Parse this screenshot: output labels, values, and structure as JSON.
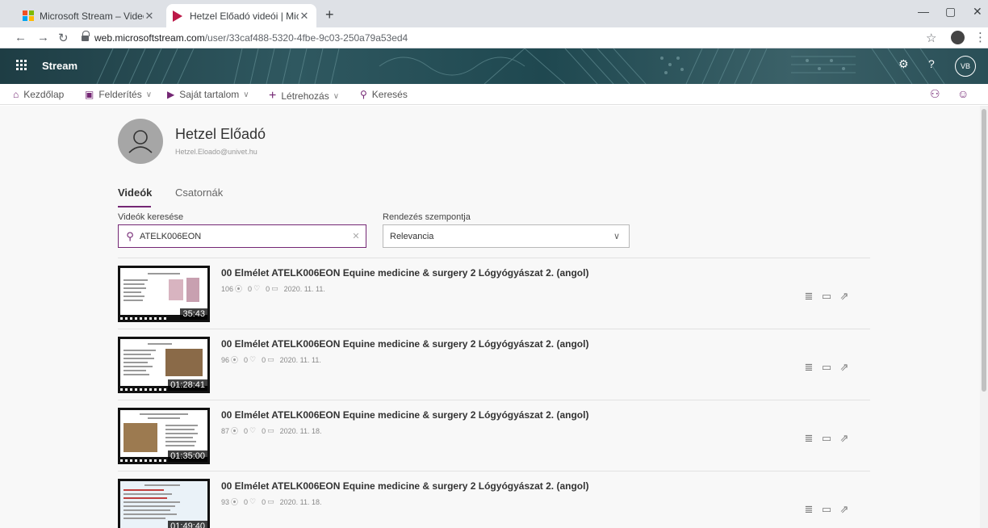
{
  "browser": {
    "tabs": [
      {
        "title": "Microsoft Stream – Videómegosz",
        "active": false
      },
      {
        "title": "Hetzel Előadó videói | Microsoft",
        "active": true
      }
    ],
    "url_host": "web.microsoftstream.com",
    "url_path": "/user/33caf488-5320-4fbe-9c03-250a79a53ed4"
  },
  "header": {
    "app_name": "Stream",
    "avatar_initials": "VB",
    "help_glyph": "?",
    "brand_color": "#742774"
  },
  "nav": {
    "home": "Kezdőlap",
    "discover": "Felderítés",
    "my_content": "Saját tartalom",
    "create": "Létrehozás",
    "search": "Keresés"
  },
  "profile": {
    "name": "Hetzel Előadó",
    "email": "Hetzel.Eloado@univet.hu"
  },
  "tabs": {
    "videos": "Videók",
    "channels": "Csatornák"
  },
  "filters": {
    "search_label": "Videók keresése",
    "search_value": "ATELK006EON",
    "sort_label": "Rendezés szempontja",
    "sort_value": "Relevancia"
  },
  "videos": [
    {
      "title": "00 Elmélet ATELK006EON Equine medicine & surgery 2 Lógyógyászat 2. (angol)",
      "views": "106",
      "likes": "0",
      "comments": "0",
      "date": "2020. 11. 11.",
      "duration": "35:43"
    },
    {
      "title": "00 Elmélet ATELK006EON Equine medicine & surgery 2 Lógyógyászat 2. (angol)",
      "views": "96",
      "likes": "0",
      "comments": "0",
      "date": "2020. 11. 11.",
      "duration": "01:28:41"
    },
    {
      "title": "00 Elmélet ATELK006EON Equine medicine & surgery 2 Lógyógyászat 2. (angol)",
      "views": "87",
      "likes": "0",
      "comments": "0",
      "date": "2020. 11. 18.",
      "duration": "01:35:00"
    },
    {
      "title": "00 Elmélet ATELK006EON Equine medicine & surgery 2 Lógyógyászat 2. (angol)",
      "views": "93",
      "likes": "0",
      "comments": "0",
      "date": "2020. 11. 18.",
      "duration": "01:49:40"
    }
  ]
}
